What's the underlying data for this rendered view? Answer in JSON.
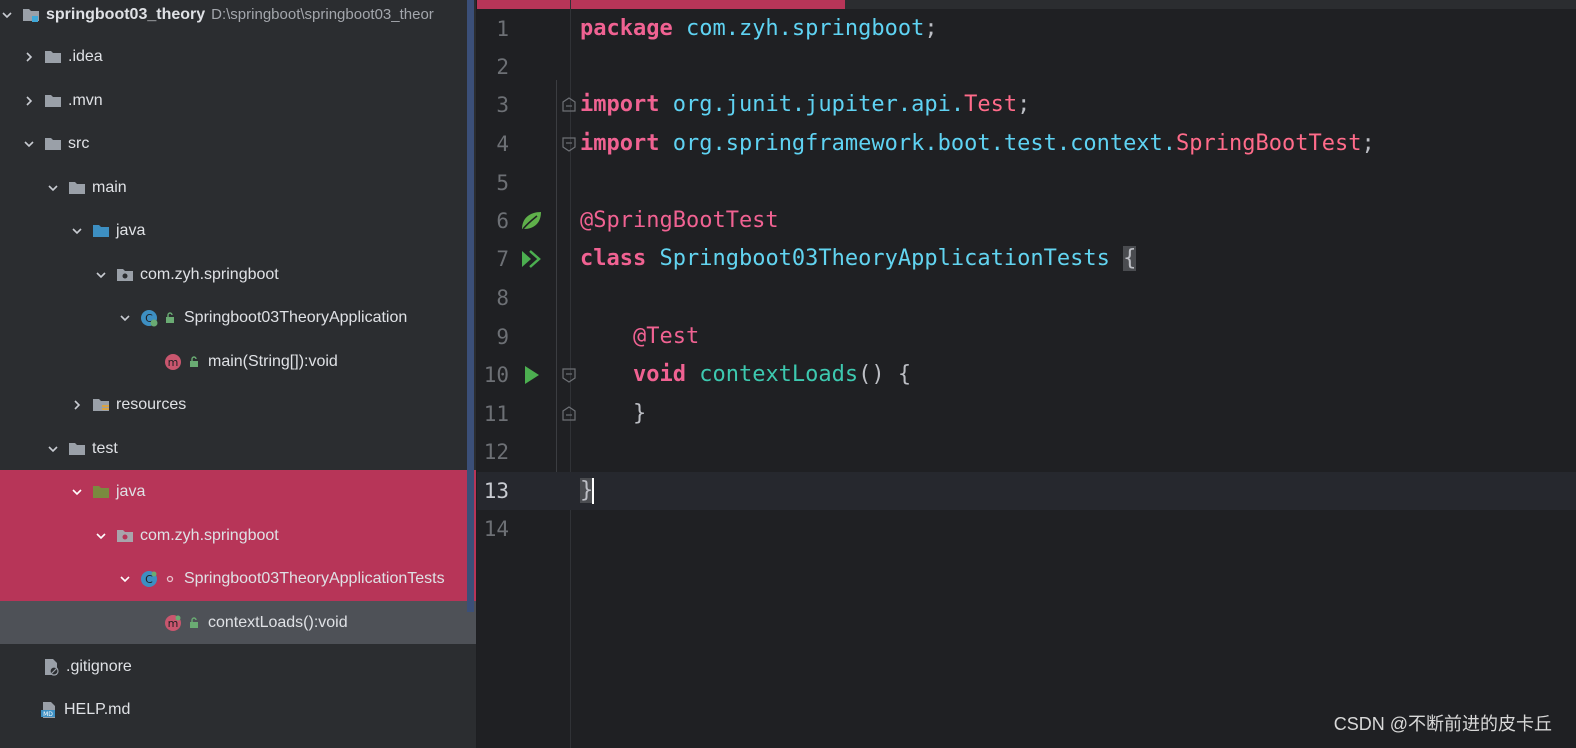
{
  "project_tree": {
    "root": {
      "name": "springboot03_theory",
      "path": "D:\\springboot\\springboot03_theor"
    },
    "items": [
      {
        "label": ".idea"
      },
      {
        "label": ".mvn"
      },
      {
        "label": "src"
      },
      {
        "label": "main"
      },
      {
        "label": "java"
      },
      {
        "label": "com.zyh.springboot"
      },
      {
        "label": "Springboot03TheoryApplication"
      },
      {
        "label": "main(String[]):void"
      },
      {
        "label": "resources"
      },
      {
        "label": "test"
      },
      {
        "label": "java"
      },
      {
        "label": "com.zyh.springboot"
      },
      {
        "label": "Springboot03TheoryApplicationTests"
      },
      {
        "label": "contextLoads():void"
      },
      {
        "label": ".gitignore"
      },
      {
        "label": "HELP.md"
      }
    ]
  },
  "editor": {
    "line_numbers": [
      "1",
      "2",
      "3",
      "4",
      "5",
      "6",
      "7",
      "8",
      "9",
      "10",
      "11",
      "12",
      "13",
      "14"
    ],
    "current_line": "13",
    "code": {
      "l1_kw": "package",
      "l1_pkg": " com.zyh.springboot",
      "l1_end": ";",
      "l3_kw": "import",
      "l3_pkg": " org.junit.jupiter.api.",
      "l3_cls": "Test",
      "l3_end": ";",
      "l4_kw": "import",
      "l4_pkg": " org.springframework.boot.test.context.",
      "l4_cls": "SpringBootTest",
      "l4_end": ";",
      "l6_ann": "@SpringBootTest",
      "l7_kw": "class",
      "l7_cls": " Springboot03TheoryApplicationTests ",
      "l7_brace": "{",
      "l9_ann": "    @Test",
      "l10_indent": "    ",
      "l10_kw": "void",
      "l10_fn": " contextLoads",
      "l10_rest": "() {",
      "l11": "    }",
      "l13": "}"
    }
  },
  "watermark": "CSDN @不断前进的皮卡丘",
  "colors": {
    "selection": "#b73558",
    "keyword": "#f06292",
    "package": "#5fd3f3",
    "method": "#3dc9b0"
  }
}
